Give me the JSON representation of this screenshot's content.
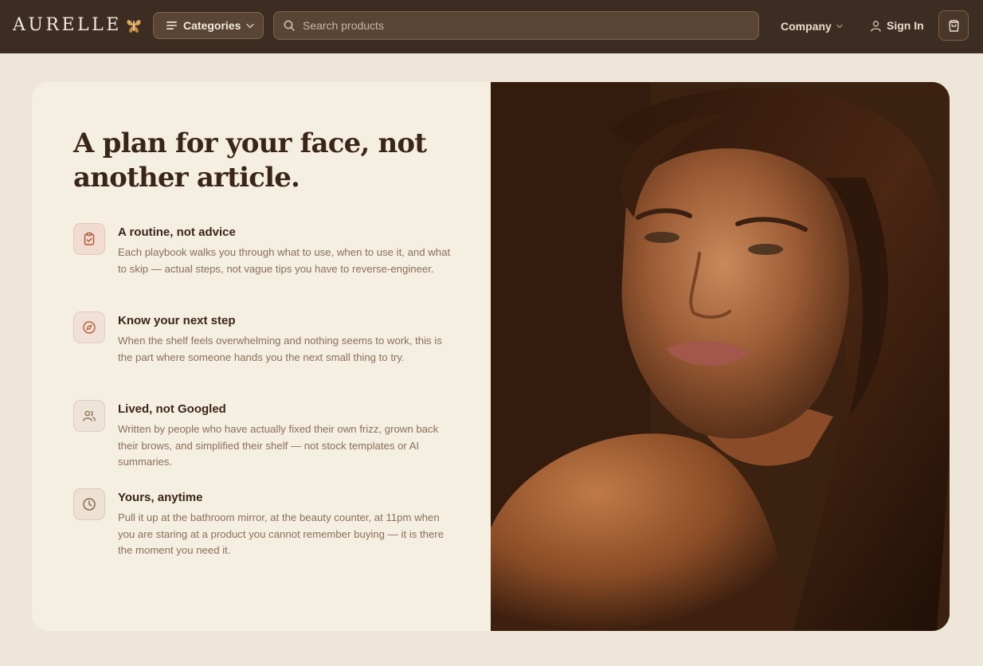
{
  "header": {
    "brand": "AURELLE",
    "categories_label": "Categories",
    "search_placeholder": "Search products",
    "company_label": "Company",
    "signin_label": "Sign In"
  },
  "hero": {
    "headline": "A plan for your face, not another article.",
    "features": [
      {
        "icon": "clipboard-check-icon",
        "title": "A routine, not advice",
        "description": "Each playbook walks you through what to use, when to use it, and what to skip — actual steps, not vague tips you have to reverse-engineer."
      },
      {
        "icon": "compass-icon",
        "title": "Know your next step",
        "description": "When the shelf feels overwhelming and nothing seems to work, this is the part where someone hands you the next small thing to try."
      },
      {
        "icon": "users-icon",
        "title": "Lived, not Googled",
        "description": "Written by people who have actually fixed their own frizz, grown back their brows, and simplified their shelf — not stock templates or AI summaries."
      },
      {
        "icon": "clock-icon",
        "title": "Yours, anytime",
        "description": "Pull it up at the bathroom mirror, at the beauty counter, at 11pm when you are staring at a product you cannot remember buying — it is there the moment you need it."
      }
    ]
  },
  "colors": {
    "header_bg": "#3d2c21",
    "page_bg": "#efe6da",
    "card_bg": "#f5efe2",
    "heading": "#3a2618",
    "body_text": "#8a6f5a",
    "icon_accent": "#a8532e"
  }
}
